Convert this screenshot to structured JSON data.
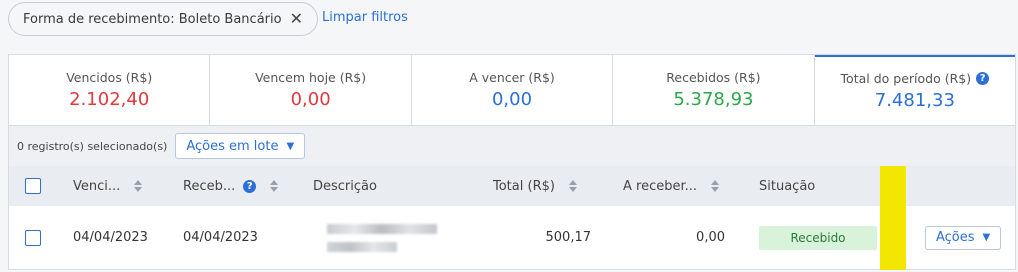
{
  "filters": {
    "chip_label": "Forma de recebimento: Boleto Bancário",
    "clear_label": "Limpar filtros"
  },
  "summary": [
    {
      "label": "Vencidos (R$)",
      "value": "2.102,40",
      "color": "#e0393e"
    },
    {
      "label": "Vencem hoje (R$)",
      "value": "0,00",
      "color": "#e0393e"
    },
    {
      "label": "A vencer (R$)",
      "value": "0,00",
      "color": "#2c6fd6"
    },
    {
      "label": "Recebidos (R$)",
      "value": "5.378,93",
      "color": "#2aa84a"
    },
    {
      "label": "Total do período (R$)",
      "value": "7.481,33",
      "color": "#2c6fd6"
    }
  ],
  "selection": {
    "count_label": "0 registro(s) selecionado(s)",
    "batch_label": "Ações em lote"
  },
  "table": {
    "headers": {
      "vencimento": "Venci...",
      "recebimento": "Receb...",
      "descricao": "Descrição",
      "total": "Total (R$)",
      "a_receber": "A receber...",
      "situacao": "Situação"
    },
    "rows": [
      {
        "vencimento": "04/04/2023",
        "recebimento": "04/04/2023",
        "total": "500,17",
        "a_receber": "0,00",
        "situacao": "Recebido",
        "acoes_label": "Ações"
      }
    ]
  }
}
